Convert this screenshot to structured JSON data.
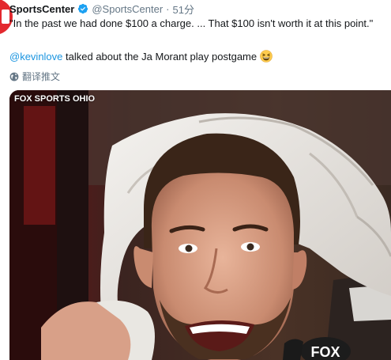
{
  "tweet": {
    "display_name": "SportsCenter",
    "handle": "@SportsCenter",
    "separator": "·",
    "time": "51分",
    "line1": "\"In the past we had done $100 a charge. ... That $100 isn't worth it at this point.\"",
    "mention": "@kevinlove",
    "line2_rest": " talked about the Ja Morant play postgame",
    "emoji": "grinning-squinting-face",
    "translate_label": "翻译推文"
  },
  "media": {
    "watermark": "FOX SPORTS OHIO",
    "microphone_logo": "FOX"
  },
  "colors": {
    "link": "#1b95e0",
    "text": "#14171a",
    "secondary": "#657786",
    "verified": "#1da1f2",
    "avatar": "#e3282e"
  }
}
